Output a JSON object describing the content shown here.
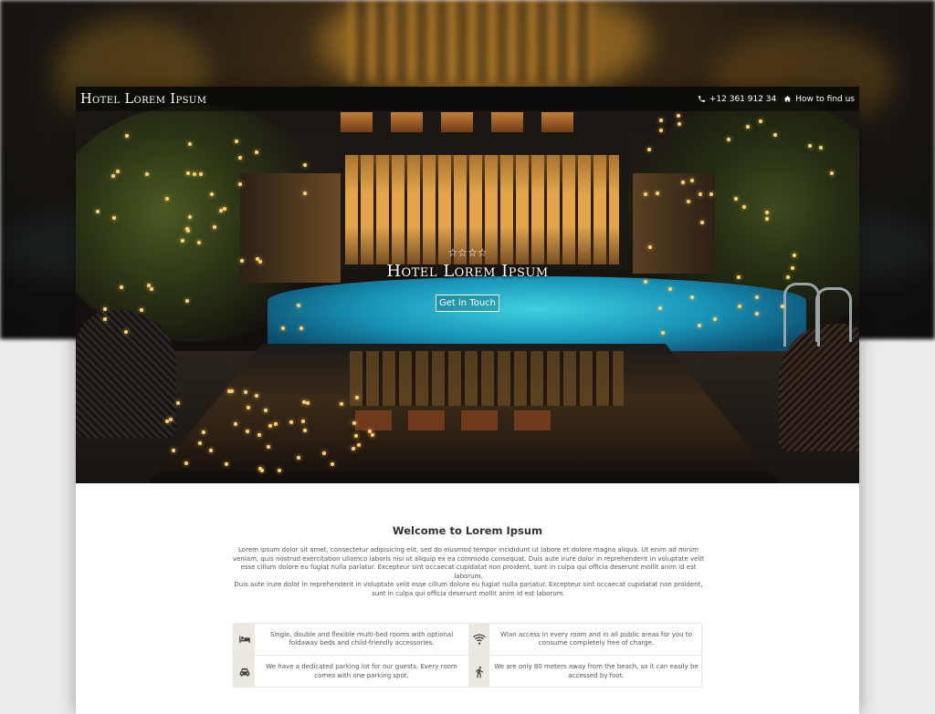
{
  "header": {
    "brand": "Hotel Lorem Ipsum",
    "phone": "+12 361 912 34",
    "find_us": "How to find us"
  },
  "hero": {
    "stars": "☆☆☆☆",
    "title": "Hotel Lorem Ipsum",
    "cta_label": "Get in Touch"
  },
  "content": {
    "welcome_title": "Welcome to Lorem Ipsum",
    "paragraph1": "Lorem ipsum dolor sit amet, consectetur adipisicing elit, sed do eiusmod tempor incididunt ut labore et dolore magna aliqua. Ut enim ad minim veniam, quis nostrud exercitation ullamco laboris nisi ut aliquip ex ea commodo consequat. Duis aute irure dolor in reprehenderit in voluptate velit esse cillum dolore eu fugiat nulla pariatur. Excepteur sint occaecat cupidatat non proident, sunt in culpa qui officia deserunt mollit anim id est laborum.",
    "paragraph2": "Duis aute irure dolor in reprehenderit in voluptate velit esse cillum dolore eu fugiat nulla pariatur. Excepteur sint occaecat cupidatat non proident, sunt in culpa qui officia deserunt mollit anim id est laborum."
  },
  "features": [
    {
      "icon": "bed-icon",
      "text": "Single, double and flexible multi-bed rooms with optional foldaway beds and child-friendly accessories."
    },
    {
      "icon": "wifi-icon",
      "text": "Wlan access in every room and in all public areas for you to consume completely free of charge."
    },
    {
      "icon": "car-icon",
      "text": "We have a dedicated parking lot for our guests. Every room comes with one parking spot."
    },
    {
      "icon": "walking-icon",
      "text": "We are only 80 meters away from the beach, so it can easily be accessed by foot."
    }
  ]
}
